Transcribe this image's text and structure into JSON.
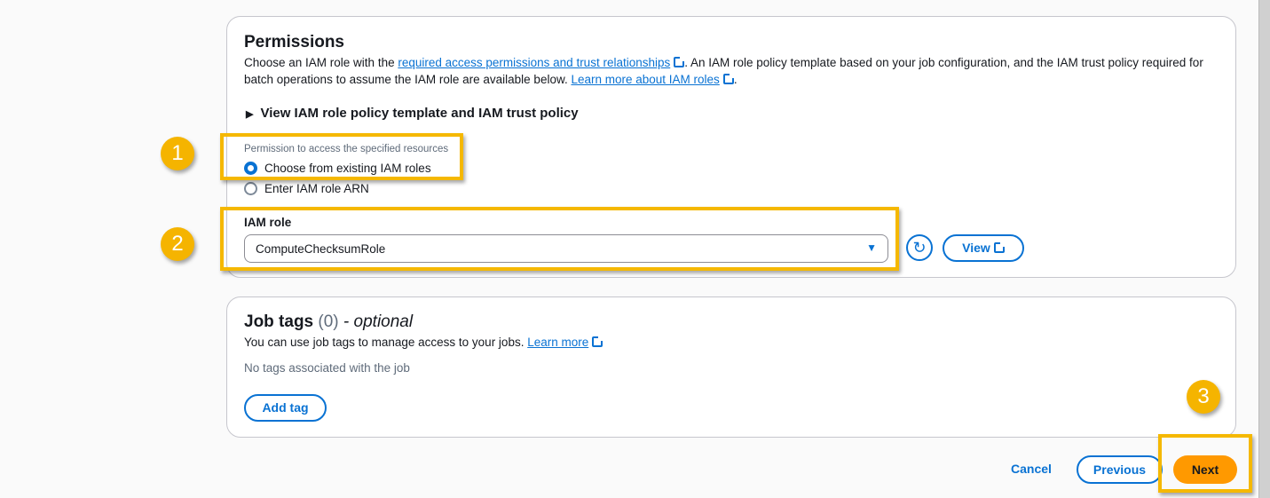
{
  "permissions": {
    "title": "Permissions",
    "desc_1": "Choose an IAM role with the ",
    "link_1": "required access permissions and trust relationships",
    "desc_2": ". An IAM role policy template based on your job configuration, and the IAM trust policy required for batch operations to assume the IAM role are available below. ",
    "link_2": "Learn more about IAM roles",
    "desc_3": ".",
    "expander": "View IAM role policy template and IAM trust policy",
    "radio_group_label": "Permission to access the specified resources",
    "radio_options": [
      "Choose from existing IAM roles",
      "Enter IAM role ARN"
    ],
    "iam_role_label": "IAM role",
    "iam_role_value": "ComputeChecksumRole",
    "view_button": "View"
  },
  "job_tags": {
    "title": "Job tags",
    "count": "(0)",
    "optional": "- optional",
    "desc": "You can use job tags to manage access to your jobs. ",
    "learn_more": "Learn more",
    "empty": "No tags associated with the job",
    "add_tag": "Add tag"
  },
  "footer": {
    "cancel": "Cancel",
    "previous": "Previous",
    "next": "Next"
  },
  "badges": [
    "1",
    "2",
    "3"
  ]
}
